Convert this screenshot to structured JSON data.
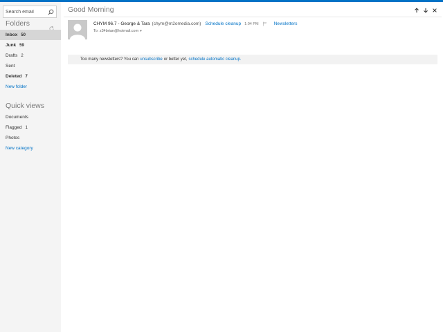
{
  "search": {
    "placeholder": "Search email"
  },
  "folders": {
    "title": "Folders",
    "items": [
      {
        "label": "Inbox",
        "count": "50"
      },
      {
        "label": "Junk",
        "count": "59"
      },
      {
        "label": "Drafts",
        "count": "2"
      },
      {
        "label": "Sent",
        "count": ""
      },
      {
        "label": "Deleted",
        "count": "7"
      }
    ],
    "new_label": "New folder"
  },
  "quick_views": {
    "title": "Quick views",
    "items": [
      {
        "label": "Documents",
        "count": ""
      },
      {
        "label": "Flagged",
        "count": "1"
      },
      {
        "label": "Photos",
        "count": ""
      }
    ],
    "new_label": "New category"
  },
  "message": {
    "subject": "Good Morning",
    "sender": "CHYM 96.7 - George & Tara",
    "sender_email": "(chym@m2omedia.com)",
    "schedule_cleanup": "Schedule cleanup",
    "time": "1:04 PM",
    "category": "Newsletters",
    "to": "To: z34brian@hotmail.com",
    "caret": "▾"
  },
  "notice": {
    "text_before": "Too many newsletters? You can",
    "unsubscribe": "unsubscribe",
    "text_middle": "or better yet,",
    "auto_cleanup": "schedule automatic cleanup."
  },
  "colors": {
    "accent": "#0072c6",
    "sidebar_bg": "#f4f4f4",
    "selected_bg": "#d6d6d6"
  }
}
